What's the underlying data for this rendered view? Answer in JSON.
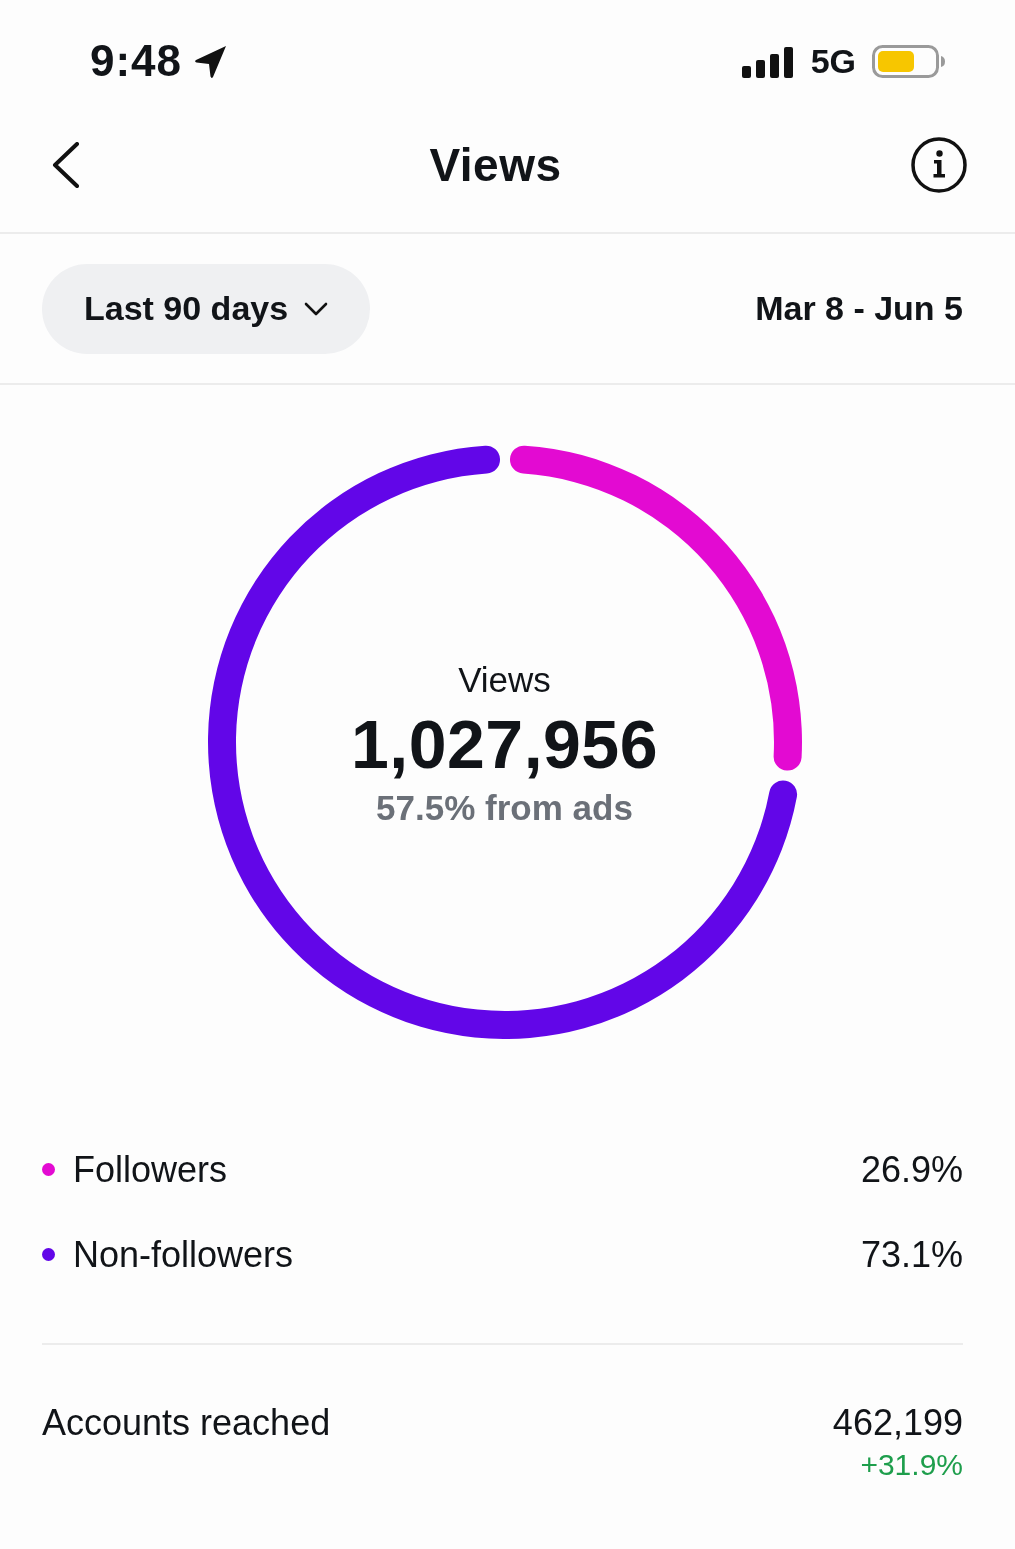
{
  "status_bar": {
    "time": "9:48",
    "network": "5G"
  },
  "nav_bar": {
    "title": "Views"
  },
  "filter": {
    "range_label": "Last 90 days",
    "date_range": "Mar 8 - Jun 5"
  },
  "views_chart": {
    "label": "Views",
    "total": "1,027,956",
    "subtitle": "57.5% from ads",
    "chart_data": {
      "type": "donut",
      "categories": [
        "Followers",
        "Non-followers"
      ],
      "values": [
        26.9,
        73.1
      ]
    }
  },
  "legend": [
    {
      "value": "26.9%",
      "color": "#e30ad2"
    },
    {
      "value": "73.1%",
      "color": "#6206e8"
    }
  ],
  "accounts_reached": {
    "label": "Accounts reached",
    "value": "462,199",
    "change": "+31.9%"
  }
}
